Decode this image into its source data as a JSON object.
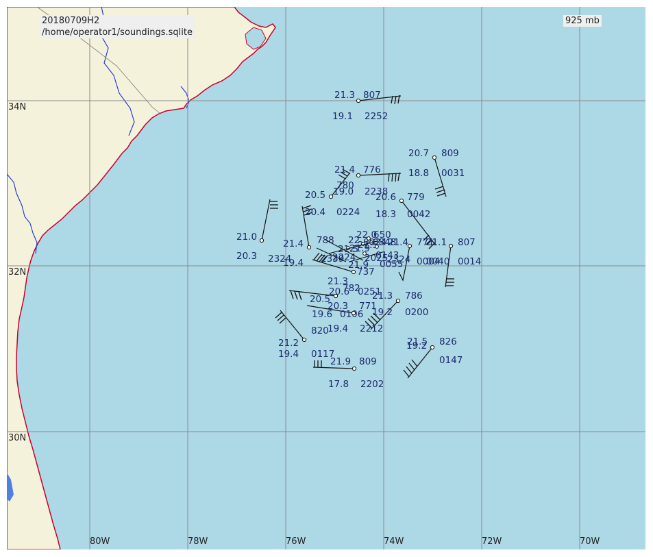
{
  "header": {
    "date_code": "20180709H2",
    "database_path": "/home/operator1/soundings.sqlite",
    "level": "925 mb"
  },
  "colors": {
    "ocean": "#add8e6",
    "land": "#f5f2dc",
    "coastline": "#c8002a",
    "rivers": "#2a3ad6",
    "grid": "#8a8a8a",
    "station_text": "#1c2a6b"
  },
  "grid": {
    "lon_labels": [
      "80W",
      "78W",
      "76W",
      "74W",
      "72W",
      "70W"
    ],
    "lat_labels": [
      "34N",
      "32N",
      "30N"
    ]
  },
  "soundings": [
    {
      "temp": "21.3",
      "dewpt": "19.1",
      "height": "807",
      "time": "2252"
    },
    {
      "temp": "20.7",
      "dewpt": "18.8",
      "height": "809",
      "time": "0031"
    },
    {
      "temp": "21.4",
      "dewpt": "19.0",
      "height": "776",
      "time": "2238"
    },
    {
      "temp": "20.6",
      "dewpt": "18.3",
      "height": "779",
      "time": "0042"
    },
    {
      "temp": "20.5",
      "dewpt": "20.4",
      "height": "780",
      "time": "0224"
    },
    {
      "temp": "21.0",
      "dewpt": "20.3",
      "height": "",
      "time": ""
    },
    {
      "temp": "21.4",
      "dewpt": "19.4",
      "height": "",
      "time": "2324"
    },
    {
      "temp": "21.1",
      "dewpt": "0040",
      "height": "807",
      "time": "0014"
    },
    {
      "temp": "21.4",
      "dewpt": "",
      "height": "771",
      "time": "0004"
    },
    {
      "temp": "21.3",
      "dewpt": "20.6",
      "height": "737",
      "time": "0251"
    },
    {
      "temp": "20.5",
      "dewpt": "19.6",
      "height": "782",
      "time": "0106"
    },
    {
      "temp": "21.3",
      "dewpt": "19.2",
      "height": "786",
      "time": "0200"
    },
    {
      "temp": "20.3",
      "dewpt": "19.4",
      "height": "771",
      "time": "2212"
    },
    {
      "temp": "21.2",
      "dewpt": "19.4",
      "height": "820",
      "time": "0117"
    },
    {
      "temp": "21.5",
      "dewpt": "19.2",
      "height": "826",
      "time": "0147"
    },
    {
      "temp": "21.9",
      "dewpt": "17.8",
      "height": "809",
      "time": "2202"
    }
  ],
  "cluster_labels": [
    "22.0",
    "650",
    "788",
    "22",
    "21.9",
    "21.5",
    "2224",
    "2339",
    "2025",
    "0055",
    "21.9",
    "21.5",
    "0143",
    "2324",
    "0024",
    "0848"
  ]
}
